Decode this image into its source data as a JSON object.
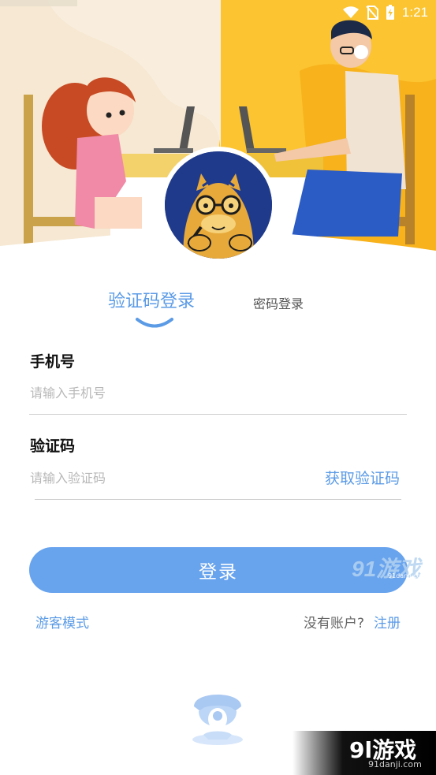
{
  "status_bar": {
    "time": "1:21",
    "icons": [
      "wifi-icon",
      "no-sim-icon",
      "battery-charging-icon"
    ]
  },
  "colors": {
    "accent": "#5b9be6",
    "button": "#68a3ee",
    "hero_left_bg": "#f6e8d2",
    "hero_right_bg": "#fbc430",
    "avatar_bg": "#1f3a8a"
  },
  "tabs": {
    "active": "验证码登录",
    "inactive": "密码登录"
  },
  "phone": {
    "label": "手机号",
    "placeholder": "请输入手机号"
  },
  "code": {
    "label": "验证码",
    "placeholder": "请输入验证码",
    "get_code": "获取验证码"
  },
  "login_button": "登录",
  "footer": {
    "guest_mode": "游客模式",
    "no_account": "没有账户?",
    "register": "注册"
  },
  "watermarks": {
    "top_main": "91游戏",
    "top_sub": "91danji.com",
    "bottom_main": "9l游戏",
    "bottom_sub": "91danji.com"
  }
}
